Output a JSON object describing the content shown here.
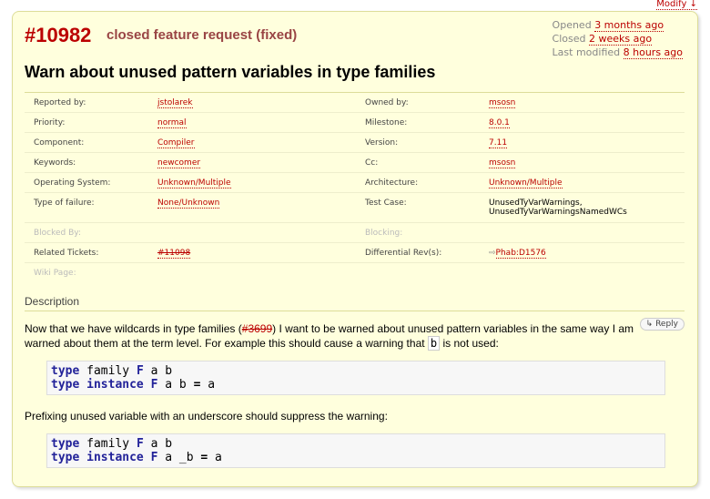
{
  "modify_label": "Modify ↓",
  "ticket": {
    "id": "#10982",
    "type": "closed feature request (fixed)",
    "summary": "Warn about unused pattern variables in type families",
    "dates": {
      "opened_label": "Opened",
      "opened_value": "3 months ago",
      "closed_label": "Closed",
      "closed_value": "2 weeks ago",
      "modified_label": "Last modified",
      "modified_value": "8 hours ago"
    },
    "properties": {
      "reported_by_label": "Reported by:",
      "reported_by": "jstolarek",
      "owned_by_label": "Owned by:",
      "owned_by": "msosn",
      "priority_label": "Priority:",
      "priority": "normal",
      "milestone_label": "Milestone:",
      "milestone": "8.0.1",
      "component_label": "Component:",
      "component": "Compiler",
      "version_label": "Version:",
      "version": "7.11",
      "keywords_label": "Keywords:",
      "keywords": "newcomer",
      "cc_label": "Cc:",
      "cc": "msosn",
      "os_label": "Operating System:",
      "os": "Unknown/Multiple",
      "arch_label": "Architecture:",
      "arch": "Unknown/Multiple",
      "failure_label": "Type of failure:",
      "failure": "None/Unknown",
      "testcase_label": "Test Case:",
      "testcase_1": "UnusedTyVarWarnings,",
      "testcase_2": "UnusedTyVarWarningsNamedWCs",
      "blocked_by_label": "Blocked By:",
      "blocking_label": "Blocking:",
      "related_label": "Related Tickets:",
      "related": "#11098",
      "diffrev_label": "Differential Rev(s):",
      "diffrev": "Phab:D1576",
      "wiki_label": "Wiki Page:"
    },
    "description": {
      "heading": "Description",
      "reply_label": "Reply",
      "p1_a": "Now that we have wildcards in type families (",
      "p1_link": "#3699",
      "p1_b": ") I want to be warned about unused pattern variables in the same way I am warned about them at the term level. For example this should cause a warning that ",
      "p1_code": "b",
      "p1_c": " is not used:",
      "code1_line1": [
        "type",
        " family ",
        "F",
        " a b"
      ],
      "code1_line2": [
        "type",
        " ",
        "instance",
        " ",
        "F",
        " a b ",
        "=",
        " a"
      ],
      "p2": "Prefixing unused variable with an underscore should suppress the warning:",
      "code2_line1": [
        "type",
        " family ",
        "F",
        " a b"
      ],
      "code2_line2": [
        "type",
        " ",
        "instance",
        " ",
        "F",
        " a _b ",
        "=",
        " a"
      ]
    }
  },
  "colors": {
    "link": "#bb0000",
    "ticket_bg": "#ffffdd",
    "keyword": "#222299"
  }
}
